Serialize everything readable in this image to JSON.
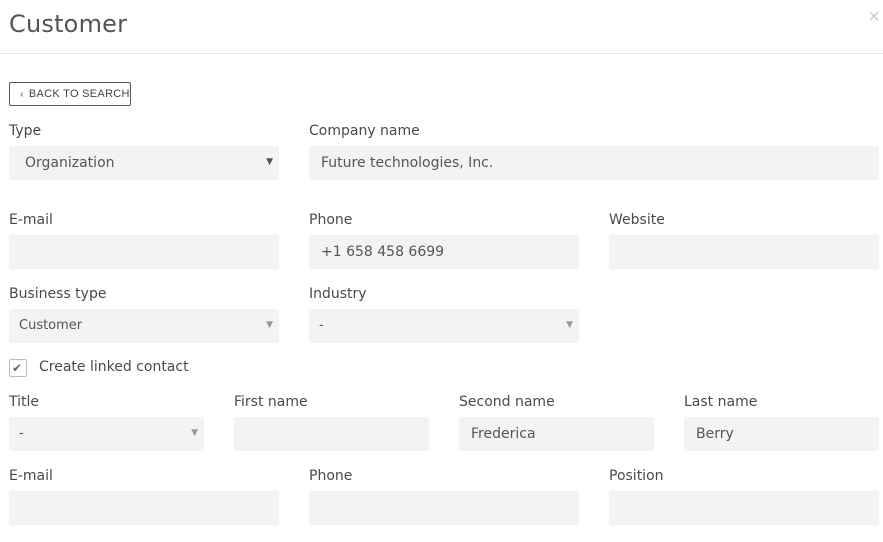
{
  "header": {
    "title": "Customer",
    "close_glyph": "×"
  },
  "toolbar": {
    "back_label": "BACK TO SEARCH"
  },
  "organization": {
    "type_label": "Type",
    "type_value": "Organization",
    "company_label": "Company name",
    "company_value": "Future technologies, Inc.",
    "email_label": "E-mail",
    "email_value": "",
    "phone_label": "Phone",
    "phone_value": "+1 658 458 6699",
    "website_label": "Website",
    "website_value": "",
    "business_type_label": "Business type",
    "business_type_value": "Customer",
    "industry_label": "Industry",
    "industry_value": "-"
  },
  "linked_contact": {
    "checkbox_label": "Create linked contact",
    "checked": true,
    "title_label": "Title",
    "title_value": "-",
    "first_name_label": "First name",
    "first_name_value": "",
    "second_name_label": "Second name",
    "second_name_value": "Frederica",
    "last_name_label": "Last name",
    "last_name_value": "Berry",
    "email_label": "E-mail",
    "email_value": "",
    "phone_label": "Phone",
    "phone_value": "",
    "position_label": "Position",
    "position_value": ""
  },
  "icons": {
    "close": "close-icon",
    "back": "chevron-left-icon",
    "dropdown": "caret-down-icon",
    "check": "checkmark-icon"
  }
}
